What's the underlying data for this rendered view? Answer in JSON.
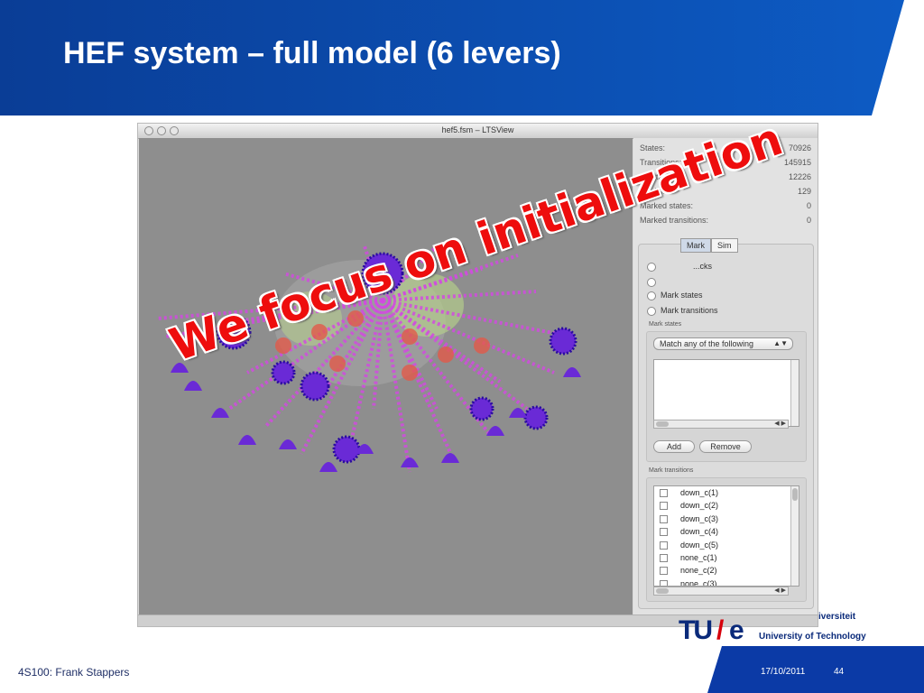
{
  "slide": {
    "title": "HEF system – full model (6 levers)",
    "overlay_text": "We focus on initialization",
    "footer_left": "4S100: Frank Stappers",
    "date": "17/10/2011",
    "page_number": "44"
  },
  "window": {
    "title": "hef5.fsm – LTSView"
  },
  "stats": [
    {
      "label": "States:",
      "value": "70926"
    },
    {
      "label": "Transitions:",
      "value": "145915"
    },
    {
      "label": "Clusters:",
      "value": "12226"
    },
    {
      "label": "Ranks:",
      "value": "129"
    },
    {
      "label": "Marked states:",
      "value": "0"
    },
    {
      "label": "Marked transitions:",
      "value": "0"
    }
  ],
  "tabs": {
    "mark": "Mark",
    "simulation": "Sim"
  },
  "mark_options": {
    "partial_1": "...cks",
    "mark_states": "Mark states",
    "mark_transitions": "Mark transitions"
  },
  "mark_states": {
    "label": "Mark states",
    "match_select": "Match any of the following",
    "add_button": "Add",
    "remove_button": "Remove"
  },
  "mark_transitions": {
    "label": "Mark transitions",
    "items": [
      "down_c(1)",
      "down_c(2)",
      "down_c(3)",
      "down_c(4)",
      "down_c(5)",
      "none_c(1)",
      "none_c(2)",
      "none_c(3)"
    ]
  },
  "logo": {
    "mark": "TU",
    "mark_e": "e",
    "line1": "iversiteit",
    "line2": "University of Technology"
  },
  "colors": {
    "header_blue": "#0a4aa8",
    "footer_blue": "#0b3aa6",
    "overlay_red": "#ee0d0d",
    "viz_purple": "#6a2ad6",
    "viz_magenta": "#d24ce0"
  }
}
